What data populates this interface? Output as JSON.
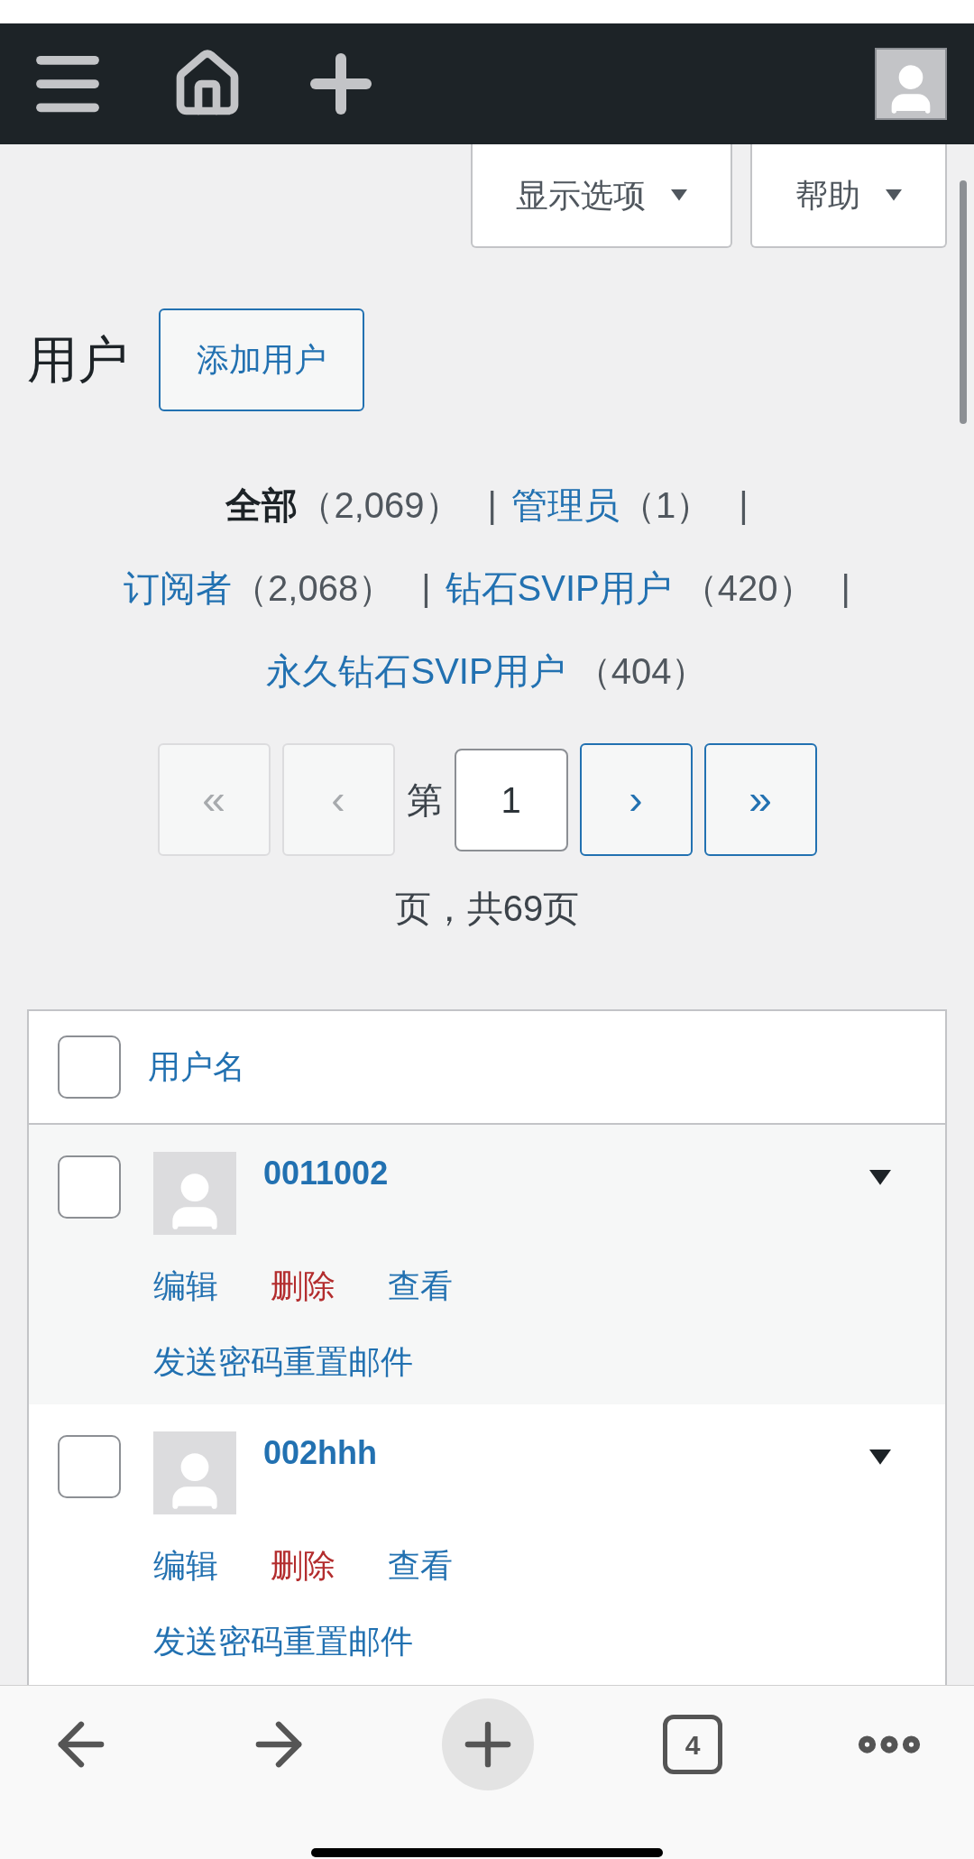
{
  "screen_tabs": [
    {
      "label": "显示选项",
      "expanded": false
    },
    {
      "label": "帮助",
      "expanded": false
    }
  ],
  "page_title": "用户",
  "add_button": "添加用户",
  "filters": [
    {
      "label": "全部",
      "count": "（2,069）",
      "selected": true,
      "separator": "|"
    },
    {
      "label": "管理员",
      "count": "（1）",
      "selected": false,
      "separator": "|"
    },
    {
      "label": "订阅者",
      "count": "（2,068）",
      "selected": false,
      "separator": "|"
    },
    {
      "label": "钻石SVIP用户",
      "count": " （420）",
      "selected": false,
      "separator": "|"
    },
    {
      "label": "永久钻石SVIP用户",
      "count": " （404）",
      "selected": false
    }
  ],
  "pagination": {
    "buttons_before": [
      {
        "label": "«",
        "disabled": true
      },
      {
        "label": "‹",
        "disabled": true
      }
    ],
    "prefix": "第",
    "page": "1",
    "buttons_after": [
      {
        "label": "›",
        "disabled": false
      },
      {
        "label": "»",
        "disabled": false
      }
    ],
    "suffix": "页，共69页"
  },
  "table": {
    "column": "用户名",
    "header_checked": false,
    "rows": [
      {
        "username": "0011002",
        "checked": false,
        "actions": [
          {
            "label": "编辑",
            "kind": "normal"
          },
          {
            "label": "删除",
            "kind": "danger"
          },
          {
            "label": "查看",
            "kind": "normal"
          }
        ],
        "reset": "发送密码重置邮件"
      },
      {
        "username": "002hhh",
        "checked": false,
        "actions": [
          {
            "label": "编辑",
            "kind": "normal"
          },
          {
            "label": "删除",
            "kind": "danger"
          },
          {
            "label": "查看",
            "kind": "normal"
          }
        ],
        "reset": "发送密码重置邮件"
      }
    ]
  },
  "browser_bar": {
    "tab_count": "4"
  }
}
